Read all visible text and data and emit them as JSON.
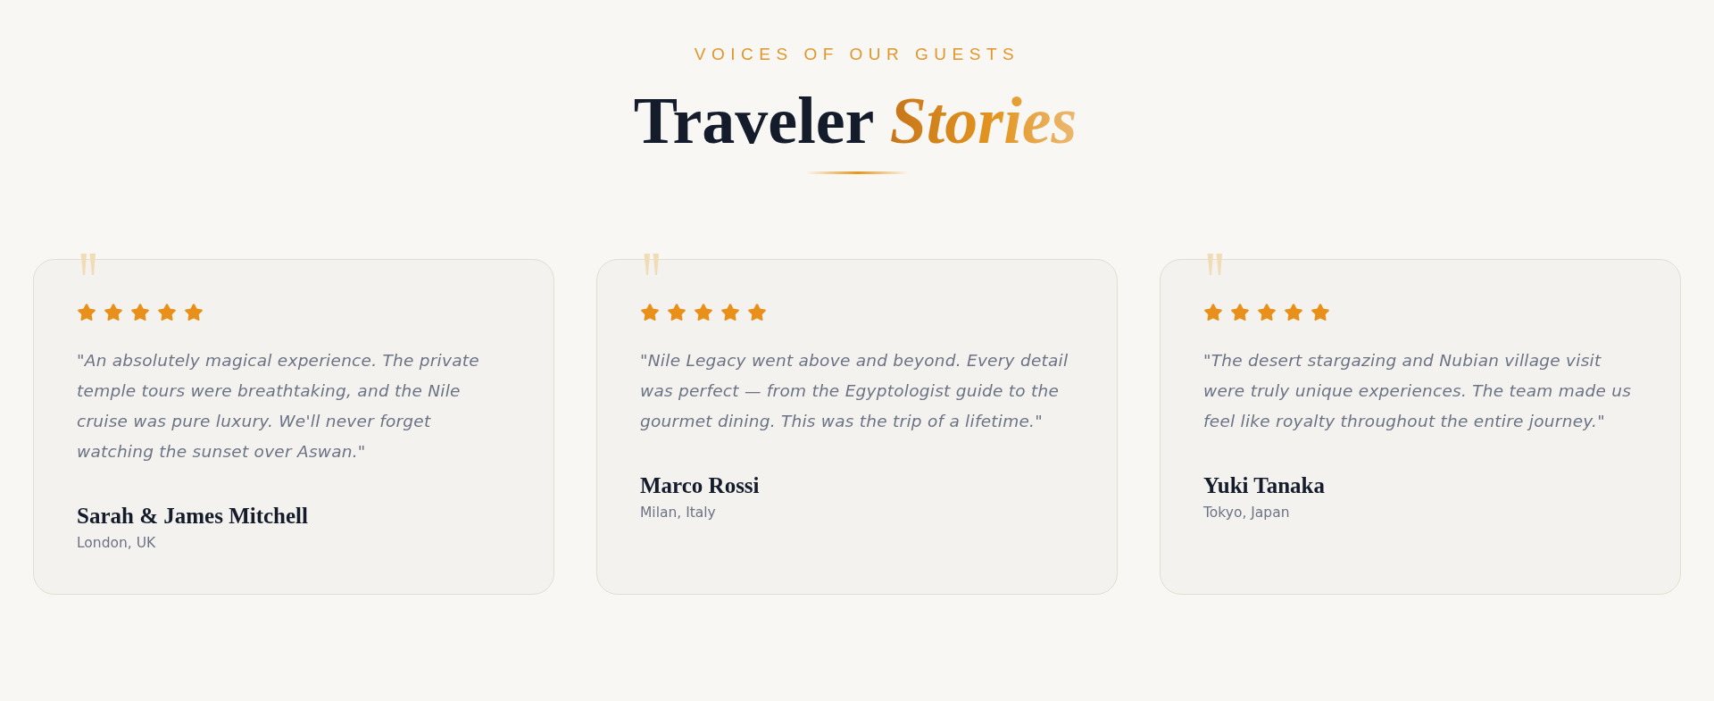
{
  "header": {
    "eyebrow": "VOICES OF OUR GUESTS",
    "title": "Traveler *Stories*"
  },
  "testimonials": [
    {
      "stars": 5,
      "quote": "\"An absolutely magical experience. The private temple tours were breathtaking, and the Nile cruise was pure luxury. We'll never forget watching the sunset over Aswan.\"",
      "name": "Sarah & James Mitchell",
      "location": "London, UK"
    },
    {
      "stars": 5,
      "quote": "\"Nile Legacy went above and beyond. Every detail was perfect — from the Egyptologist guide to the gourmet dining. This was the trip of a lifetime.\"",
      "name": "Marco Rossi",
      "location": "Milan, Italy"
    },
    {
      "stars": 5,
      "quote": "\"The desert stargazing and Nubian village visit were truly unique experiences. The team made us feel like royalty throughout the entire journey.\"",
      "name": "Yuki Tanaka",
      "location": "Tokyo, Japan"
    }
  ]
}
